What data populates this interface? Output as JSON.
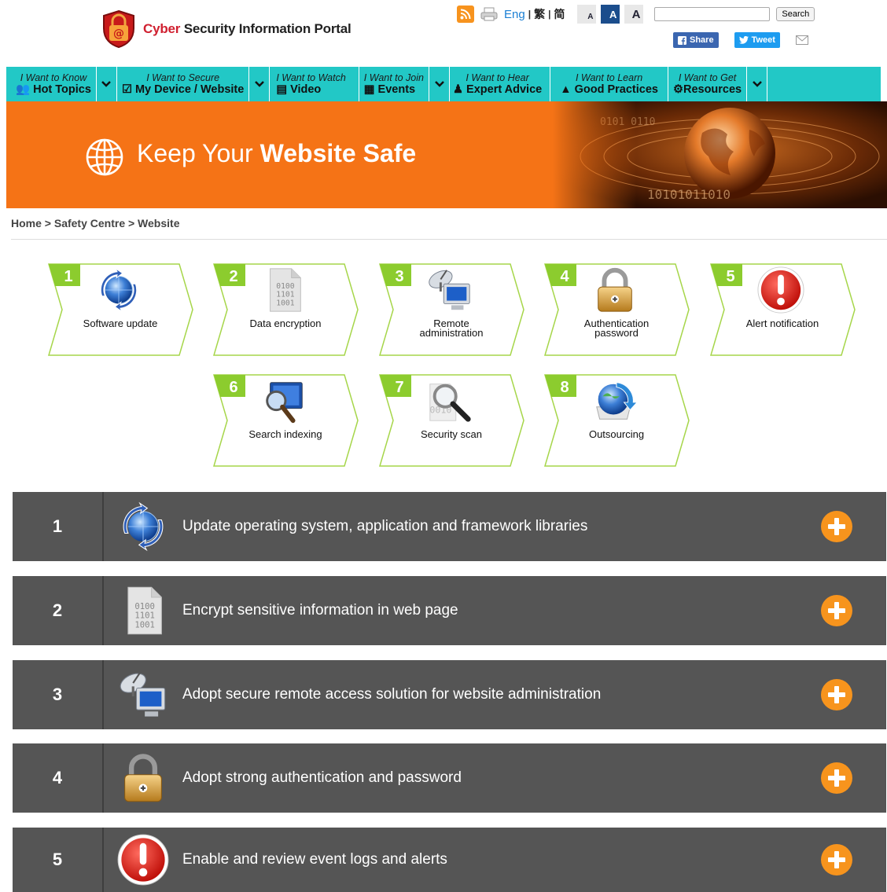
{
  "header": {
    "logo_red": "Cyber",
    "logo_rest": " Security Information Portal",
    "lang_eng": "Eng",
    "lang_sep1": "|",
    "lang_trad": "繁",
    "lang_sep2": "|",
    "lang_simp": "简",
    "font_small": "A",
    "font_medium": "A",
    "font_large": "A",
    "search_value": "",
    "search_button": "Search",
    "share_label": "Share",
    "tweet_label": "Tweet"
  },
  "nav": [
    {
      "top": "I Want to Know",
      "bottom": "Hot Topics",
      "icon": "users-icon",
      "has_caret": true
    },
    {
      "top": "I Want to Secure",
      "bottom": "My Device / Website",
      "icon": "checkbox-icon",
      "has_caret": true
    },
    {
      "top": "I Want to Watch",
      "bottom": "Video",
      "icon": "video-file-icon",
      "has_caret": false
    },
    {
      "top": "I Want to Join",
      "bottom": "Events",
      "icon": "newspaper-icon",
      "has_caret": true
    },
    {
      "top": "I Want to Hear",
      "bottom": "Expert Advice",
      "icon": "person-icon",
      "has_caret": false
    },
    {
      "top": "I Want to Learn",
      "bottom": "Good Practices",
      "icon": "graduation-cap-icon",
      "has_caret": false
    },
    {
      "top": "I Want to Get",
      "bottom": "Resources",
      "icon": "cogs-icon",
      "has_caret": true
    }
  ],
  "banner": {
    "title_light": "Keep Your ",
    "title_bold": "Website Safe"
  },
  "breadcrumb": "Home > Safety Centre > Website",
  "steps": [
    {
      "num": "1",
      "label": "Software update",
      "icon": "refresh-globe-icon"
    },
    {
      "num": "2",
      "label": "Data encryption",
      "icon": "binary-file-icon"
    },
    {
      "num": "3",
      "label": "Remote administration",
      "icon": "satellite-computer-icon"
    },
    {
      "num": "4",
      "label": "Authentication password",
      "icon": "padlock-icon"
    },
    {
      "num": "5",
      "label": "Alert notification",
      "icon": "alert-icon"
    },
    {
      "num": "6",
      "label": "Search indexing",
      "icon": "search-monitor-icon"
    },
    {
      "num": "7",
      "label": "Security scan",
      "icon": "magnifier-scan-icon"
    },
    {
      "num": "8",
      "label": "Outsourcing",
      "icon": "globe-arrows-icon"
    }
  ],
  "accordion": [
    {
      "num": "1",
      "text": "Update operating system, application and framework libraries",
      "icon": "refresh-globe-icon"
    },
    {
      "num": "2",
      "text": "Encrypt sensitive information in web page",
      "icon": "binary-file-icon"
    },
    {
      "num": "3",
      "text": "Adopt secure remote access solution for website administration",
      "icon": "satellite-computer-icon"
    },
    {
      "num": "4",
      "text": "Adopt strong authentication and password",
      "icon": "padlock-icon"
    },
    {
      "num": "5",
      "text": "Enable and review event logs and alerts",
      "icon": "alert-icon"
    }
  ],
  "colors": {
    "nav_bg": "#22c8c6",
    "banner_bg": "#f57316",
    "step_green": "#8ccc2e",
    "accordion_bg": "#555555",
    "plus_orange": "#f7941d"
  }
}
